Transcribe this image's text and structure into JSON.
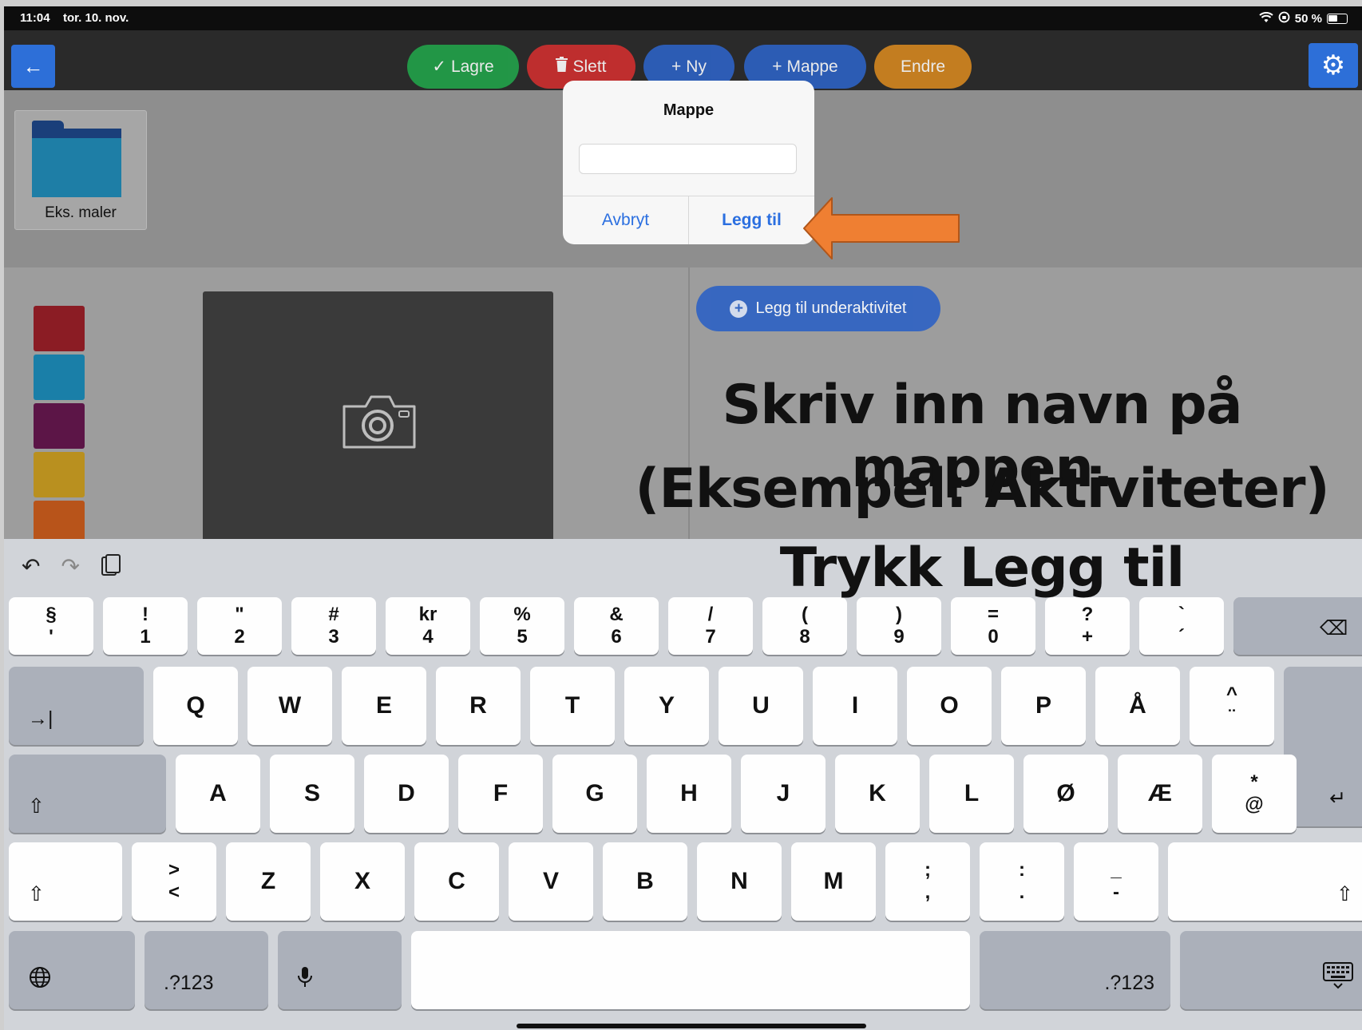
{
  "status_bar": {
    "time": "11:04",
    "date": "tor. 10. nov.",
    "right": "50 %"
  },
  "toolbar": {
    "back_icon": "arrow-left-icon",
    "buttons": [
      {
        "label": "Lagre",
        "icon": "✓",
        "color": "#22a24a"
      },
      {
        "label": "Slett",
        "icon": "🗑",
        "color": "#cf2f2f"
      },
      {
        "label": "Ny",
        "icon": "+",
        "color": "#2d62c4"
      },
      {
        "label": "Mappe",
        "icon": "+",
        "color": "#2d62c4"
      },
      {
        "label": "Endre",
        "icon": "",
        "color": "#d4861f"
      }
    ],
    "settings_icon": "gear-icon"
  },
  "folders": [
    {
      "label": "Eks. maler"
    }
  ],
  "colors": [
    "#8b1c24",
    "#1a7fa8",
    "#5c1547",
    "#b9901f",
    "#b8541a"
  ],
  "subactivity_button": "Legg til underaktivitet",
  "dialog": {
    "title": "Mappe",
    "input_value": "",
    "cancel": "Avbryt",
    "confirm": "Legg til"
  },
  "instructions": {
    "line1": "Skriv inn navn på mappen.",
    "line2": "(Eksempel: Aktiviteter)",
    "line3": "Trykk Legg til"
  },
  "keyboard": {
    "number_row": [
      {
        "top": "§",
        "bot": "'"
      },
      {
        "top": "!",
        "bot": "1"
      },
      {
        "top": "\"",
        "bot": "2"
      },
      {
        "top": "#",
        "bot": "3"
      },
      {
        "top": "kr",
        "bot": "4"
      },
      {
        "top": "%",
        "bot": "5"
      },
      {
        "top": "&",
        "bot": "6"
      },
      {
        "top": "/",
        "bot": "7"
      },
      {
        "top": "(",
        "bot": "8"
      },
      {
        "top": ")",
        "bot": "9"
      },
      {
        "top": "=",
        "bot": "0"
      },
      {
        "top": "?",
        "bot": "+"
      },
      {
        "top": "`",
        "bot": "´"
      }
    ],
    "row1": [
      "Q",
      "W",
      "E",
      "R",
      "T",
      "Y",
      "U",
      "I",
      "O",
      "P",
      "Å"
    ],
    "row1_last": {
      "top": "^",
      "bot": "¨"
    },
    "row2": [
      "A",
      "S",
      "D",
      "F",
      "G",
      "H",
      "J",
      "K",
      "L",
      "Ø",
      "Æ"
    ],
    "row2_last": {
      "top": "*",
      "bot": "@"
    },
    "row3_first": {
      "top": ">",
      "bot": "<"
    },
    "row3": [
      "Z",
      "X",
      "C",
      "V",
      "B",
      "N",
      "M"
    ],
    "row3_punct": [
      {
        "top": ";",
        "bot": ","
      },
      {
        "top": ":",
        "bot": "."
      },
      {
        "top": "_",
        "bot": "-"
      }
    ],
    "symbols_label": ".?123",
    "tab_symbol": "→|",
    "shift_symbol": "⇧",
    "backspace_symbol": "⌫",
    "return_symbol": "↵"
  }
}
